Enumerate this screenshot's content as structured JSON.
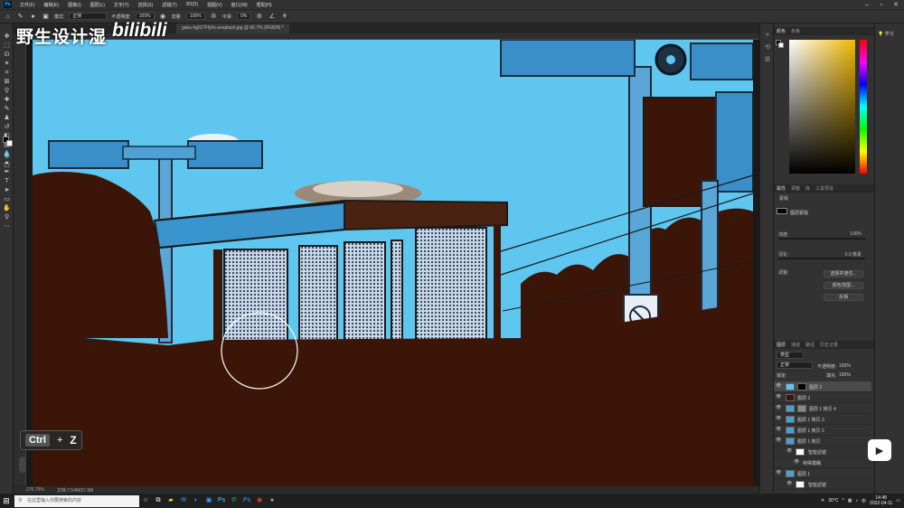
{
  "menubar": {
    "items": [
      "文件(F)",
      "编辑(E)",
      "图像(I)",
      "图层(L)",
      "文字(Y)",
      "选择(S)",
      "滤镜(T)",
      "3D(D)",
      "视图(V)",
      "窗口(W)",
      "帮助(H)"
    ],
    "logo": "Ps"
  },
  "options": {
    "mode_label": "模式:",
    "mode_value": "正常",
    "opacity_label": "不透明度:",
    "opacity_value": "100%",
    "flow_label": "流量:",
    "flow_value": "100%",
    "smooth_label": "平滑:",
    "smooth_value": "0%"
  },
  "document": {
    "tab_title": "gaku-fqjtSTFfyhs-unsplash.jpg @ 66.7% (RGB/8) *",
    "zoom_status": "275.75%",
    "doc_status": "文档:7.54M/37.9M"
  },
  "watermark": {
    "text": "野生设计湿",
    "logo": "bilibili"
  },
  "key_hint": {
    "key": "Ctrl",
    "plus": "+",
    "letter": "Z"
  },
  "color_panel": {
    "tabs": [
      "颜色",
      "色板"
    ],
    "hue_accent": "#f0b800"
  },
  "properties_panel": {
    "tabs": [
      "属性",
      "调整",
      "库",
      "工具预设"
    ],
    "section": "蒙版",
    "mask_label": "图层蒙版",
    "density_label": "浓度:",
    "density_value": "100%",
    "feather_label": "羽化:",
    "feather_value": "0.0 像素",
    "adjust_label": "调整:",
    "buttons": [
      "选择并遮住...",
      "颜色范围...",
      "反相"
    ]
  },
  "layers_panel": {
    "tabs": [
      "图层",
      "通道",
      "路径",
      "历史记录"
    ],
    "kind_label": "类型",
    "blend_mode": "正常",
    "opacity_label": "不透明度:",
    "opacity_value": "100%",
    "lock_label": "锁定:",
    "fill_label": "填充:",
    "fill_value": "100%",
    "layers": [
      {
        "name": "图层 2",
        "selected": true
      },
      {
        "name": "图层 3",
        "selected": false
      },
      {
        "name": "图层 1 拷贝 4",
        "selected": false
      },
      {
        "name": "图层 1 拷贝 3",
        "selected": false
      },
      {
        "name": "图层 1 拷贝 2",
        "selected": false
      },
      {
        "name": "图层 1 拷贝",
        "selected": false
      },
      {
        "name": "智能滤镜",
        "selected": false
      },
      {
        "name": "特殊模糊",
        "selected": false
      },
      {
        "name": "图层 1",
        "selected": false
      },
      {
        "name": "智能滤镜",
        "selected": false
      }
    ]
  },
  "learn": {
    "label": "学习"
  },
  "taskbar": {
    "search_placeholder": "在这里输入你要搜索的内容",
    "temperature": "30°C",
    "time": "14:48",
    "date": "2022-04-11",
    "ime": "中"
  },
  "colors": {
    "sky": "#5cc4ee",
    "dark_fill": "#3b1608",
    "structure": "#4a9ed1"
  }
}
